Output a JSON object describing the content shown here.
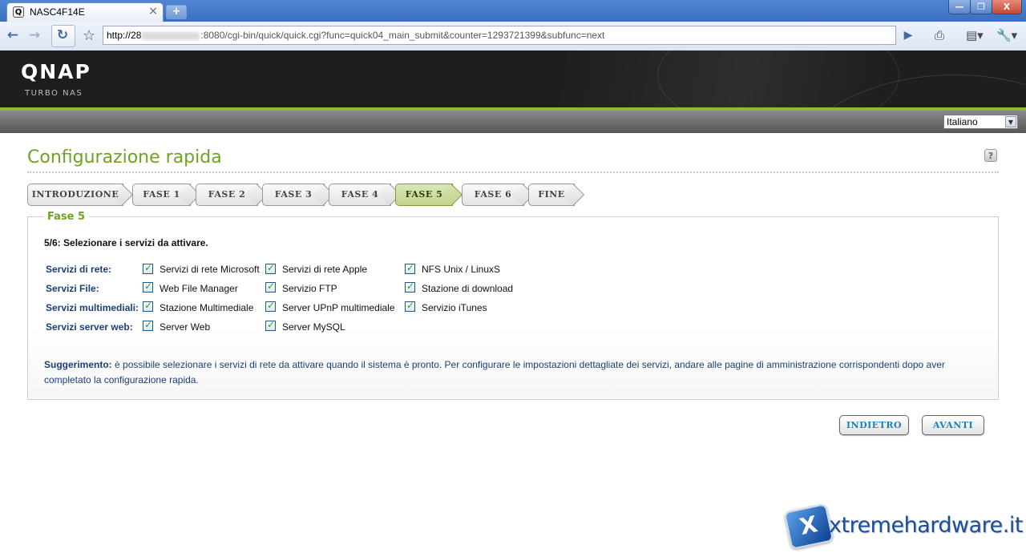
{
  "browser": {
    "tab_title": "NASC4F14E",
    "tab_icon": "Q",
    "tab_close": "×",
    "new_tab": "+",
    "url_prefix": "http://28",
    "url_suffix": ":8080/cgi-bin/quick/quick.cgi?func=quick04_main_submit&counter=1293721399&subfunc=next",
    "window_buttons": {
      "minimize": "—",
      "maximize": "❐",
      "close": "X"
    }
  },
  "header": {
    "logo": "QNAP",
    "logo_sub": "TURBO NAS",
    "language": "Italiano"
  },
  "page": {
    "title": "Configurazione rapida",
    "help": "?"
  },
  "steps": [
    {
      "label": "INTRODUZIONE",
      "active": false
    },
    {
      "label": "FASE 1",
      "active": false
    },
    {
      "label": "FASE 2",
      "active": false
    },
    {
      "label": "FASE 3",
      "active": false
    },
    {
      "label": "FASE 4",
      "active": false
    },
    {
      "label": "FASE 5",
      "active": true
    },
    {
      "label": "FASE 6",
      "active": false
    },
    {
      "label": "FINE",
      "active": false
    }
  ],
  "section": {
    "legend": "Fase 5",
    "subtitle": "5/6: Selezionare i servizi da attivare.",
    "rows": [
      {
        "label": "Servizi di rete:",
        "items": [
          {
            "label": "Servizi di rete Microsoft",
            "checked": true
          },
          {
            "label": "Servizi di rete Apple",
            "checked": true
          },
          {
            "label": "NFS Unix / LinuxS",
            "checked": true
          }
        ]
      },
      {
        "label": "Servizi File:",
        "items": [
          {
            "label": "Web File Manager",
            "checked": true
          },
          {
            "label": "Servizio FTP",
            "checked": true
          },
          {
            "label": "Stazione di download",
            "checked": true
          }
        ]
      },
      {
        "label": "Servizi multimediali:",
        "items": [
          {
            "label": "Stazione Multimediale",
            "checked": true
          },
          {
            "label": "Server UPnP multimediale",
            "checked": true
          },
          {
            "label": "Servizio iTunes",
            "checked": true
          }
        ]
      },
      {
        "label": "Servizi server web:",
        "items": [
          {
            "label": "Server Web",
            "checked": true
          },
          {
            "label": "Server MySQL",
            "checked": true
          }
        ]
      }
    ],
    "tip_label": "Suggerimento:",
    "tip_text": " è possibile selezionare i servizi di rete da attivare quando il sistema è pronto. Per configurare le impostazioni dettagliate dei servizi, andare alle pagine di amministrazione corrispondenti dopo aver completato la configurazione rapida."
  },
  "buttons": {
    "back": "INDIETRO",
    "next": "AVANTI"
  },
  "watermark": {
    "text": "xtremehardware.it",
    "badge": "X"
  },
  "colors": {
    "accent_green": "#6fa321",
    "label_blue": "#1c3f7a",
    "button_text": "#1e7fc0"
  }
}
